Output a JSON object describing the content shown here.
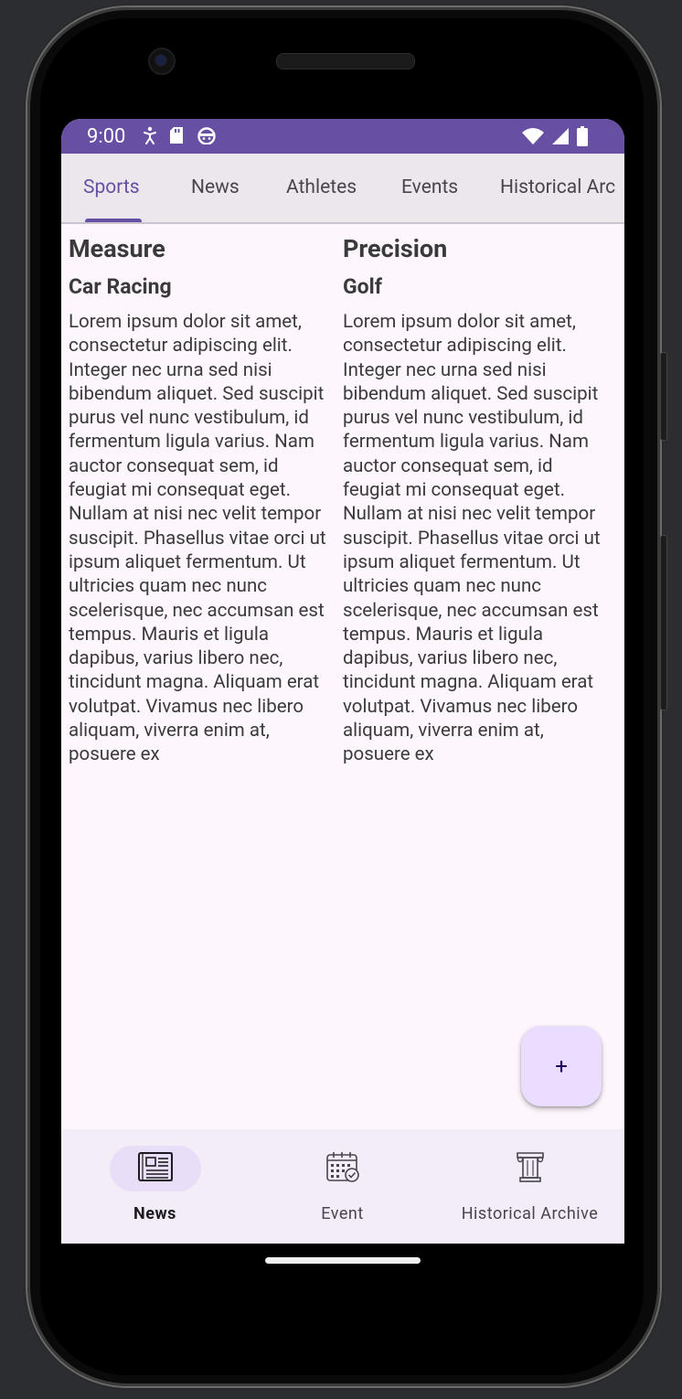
{
  "status_bar": {
    "time": "9:00",
    "left_icons": [
      "accessibility-icon",
      "sd-card-icon",
      "android-head-icon"
    ],
    "right_icons": [
      "wifi-icon",
      "signal-icon",
      "battery-icon"
    ],
    "color": "#6750a4"
  },
  "tabs": [
    {
      "label": "Sports",
      "active": true
    },
    {
      "label": "News",
      "active": false
    },
    {
      "label": "Athletes",
      "active": false
    },
    {
      "label": "Events",
      "active": false
    },
    {
      "label": "Historical Arc",
      "active": false
    }
  ],
  "articles": [
    {
      "category": "Measure",
      "title": "Car Racing",
      "body": "Lorem ipsum dolor sit amet, consectetur adipiscing elit. Integer nec urna sed nisi bibendum aliquet. Sed suscipit purus vel nunc vestibulum, id fermentum ligula varius. Nam auctor consequat sem, id feugiat mi consequat eget. Nullam at nisi nec velit tempor suscipit. Phasellus vitae orci ut ipsum aliquet fermentum. Ut ultricies quam nec nunc scelerisque, nec accumsan est tempus. Mauris et ligula dapibus, varius libero nec, tincidunt magna. Aliquam erat volutpat. Vivamus nec libero aliquam, viverra enim at, posuere ex"
    },
    {
      "category": "Precision",
      "title": "Golf",
      "body": "Lorem ipsum dolor sit amet, consectetur adipiscing elit. Integer nec urna sed nisi bibendum aliquet. Sed suscipit purus vel nunc vestibulum, id fermentum ligula varius. Nam auctor consequat sem, id feugiat mi consequat eget. Nullam at nisi nec velit tempor suscipit. Phasellus vitae orci ut ipsum aliquet fermentum. Ut ultricies quam nec nunc scelerisque, nec accumsan est tempus. Mauris et ligula dapibus, varius libero nec, tincidunt magna. Aliquam erat volutpat. Vivamus nec libero aliquam, viverra enim at, posuere ex"
    }
  ],
  "fab": {
    "label": "+",
    "icon": "plus-icon"
  },
  "bottom_nav": [
    {
      "label": "News",
      "icon": "newspaper-icon",
      "active": true
    },
    {
      "label": "Event",
      "icon": "calendar-check-icon",
      "active": false
    },
    {
      "label": "Historical Archive",
      "icon": "column-pillar-icon",
      "active": false
    }
  ],
  "colors": {
    "primary": "#6750a4",
    "background": "#fdf7fd",
    "tab_background": "#ece7ec",
    "fab_background": "#eaddff",
    "nav_background": "#f3edf7",
    "nav_pill": "#e8def8"
  }
}
